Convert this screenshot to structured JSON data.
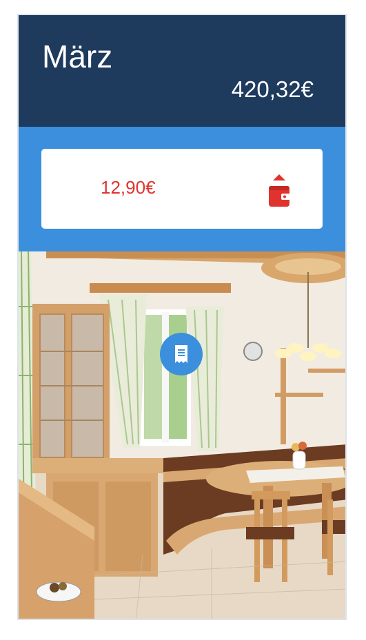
{
  "header": {
    "month": "März",
    "total": "420,32€"
  },
  "summary_card": {
    "amount": "12,90€",
    "action_icon": "wallet-up-icon",
    "amount_color": "#e0332e"
  },
  "colors": {
    "header_bg": "#1e3a5c",
    "band_bg": "#3b8fdc",
    "accent_red": "#e0332e"
  },
  "photo": {
    "subject": "kitchen-dining-room-photo"
  },
  "fab": {
    "icon": "receipt-icon"
  }
}
